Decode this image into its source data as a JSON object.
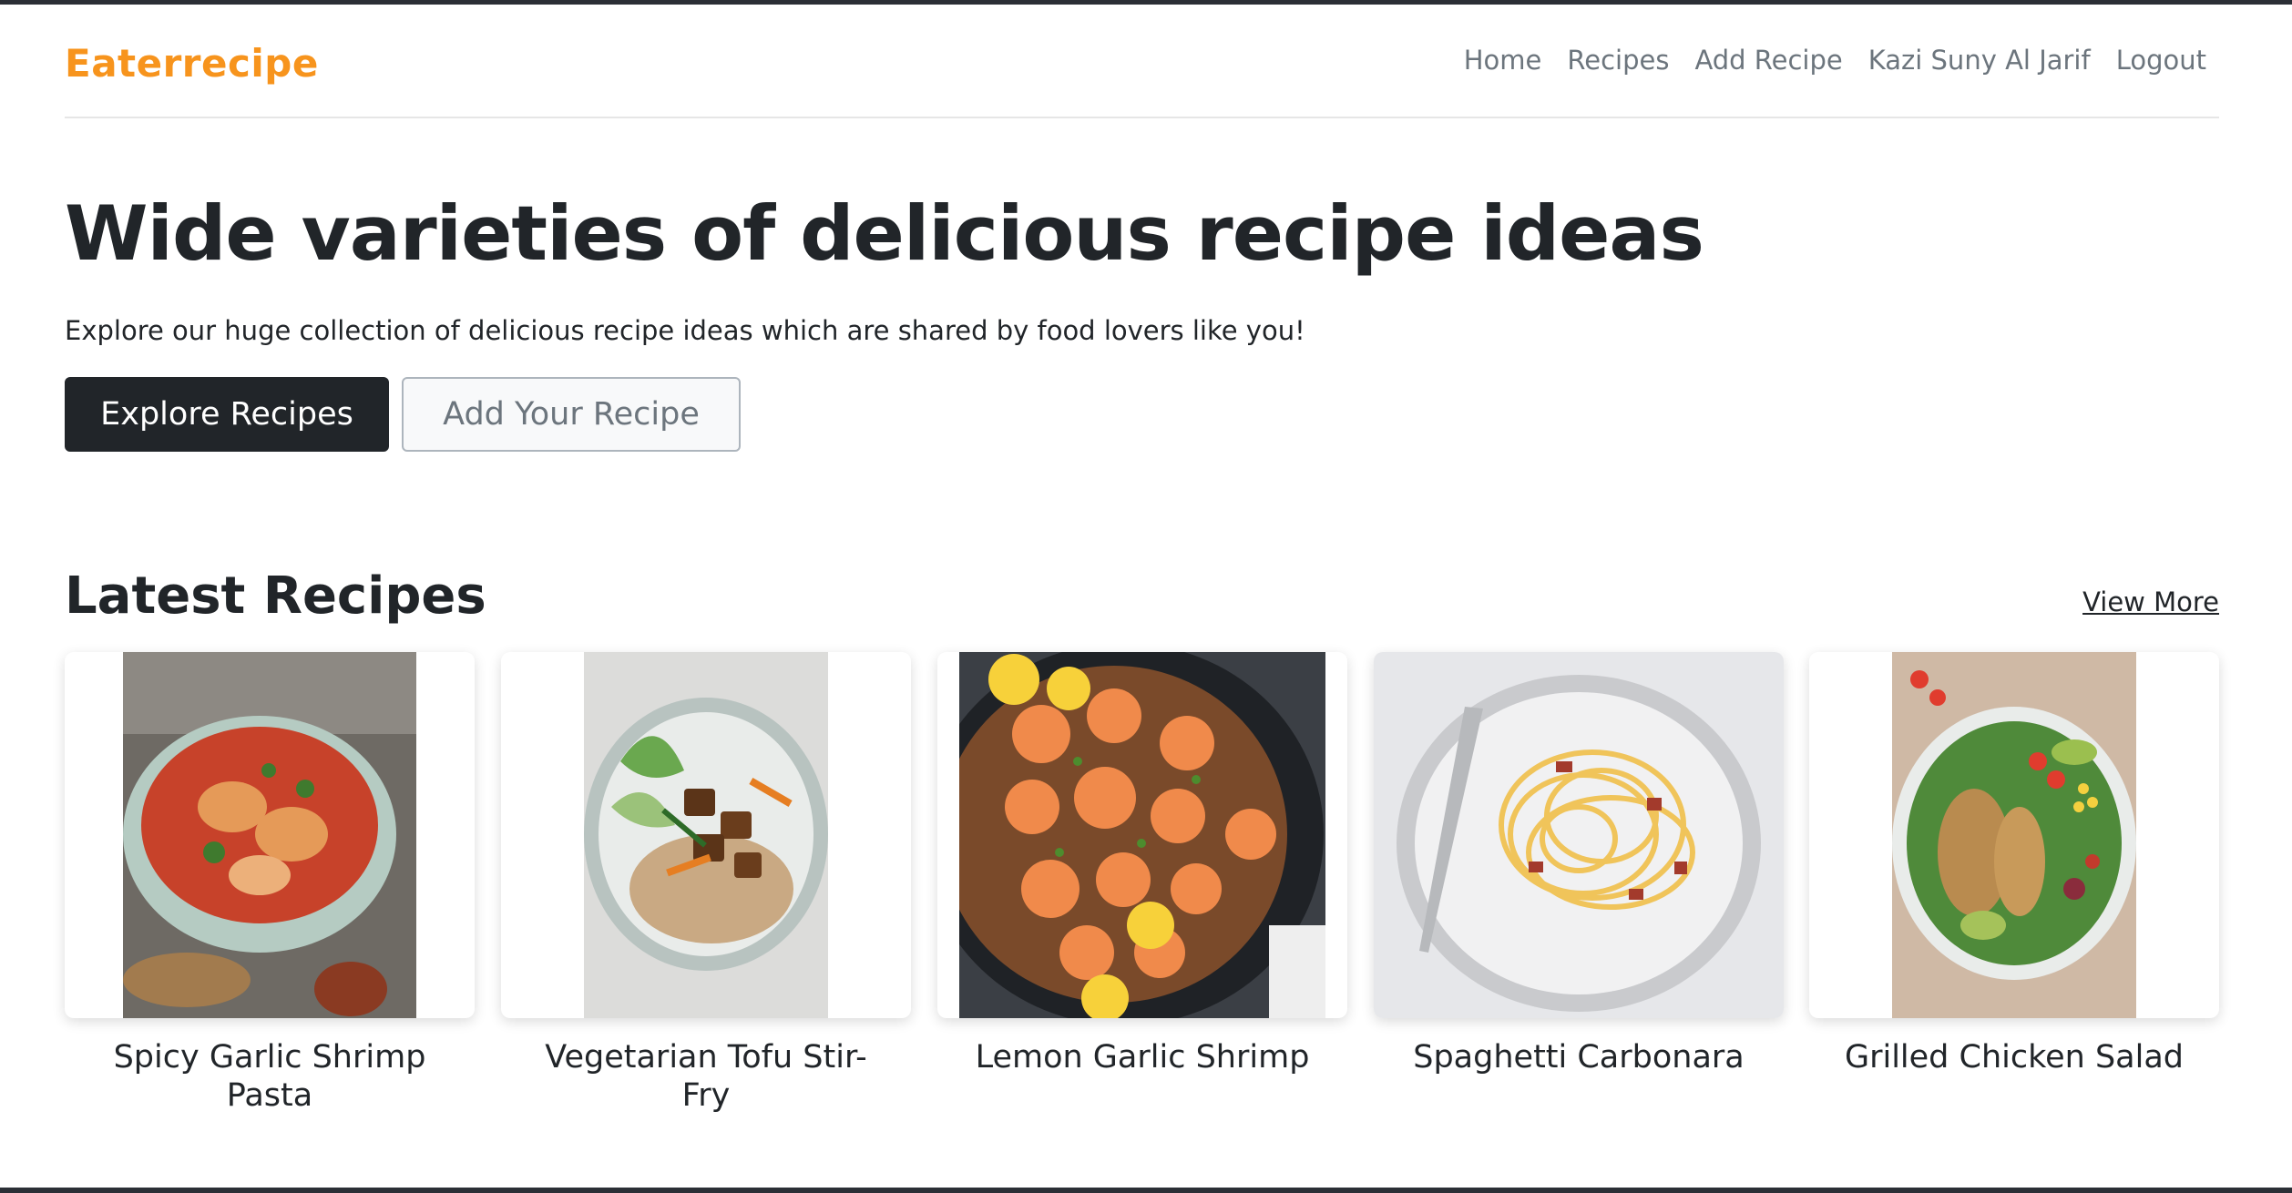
{
  "brand": "Eaterrecipe",
  "nav": {
    "links": [
      "Home",
      "Recipes",
      "Add Recipe",
      "Kazi Suny Al Jarif",
      "Logout"
    ]
  },
  "hero": {
    "title": "Wide varieties of delicious recipe ideas",
    "subtitle": "Explore our huge collection of delicious recipe ideas which are shared by food lovers like you!",
    "primary_button": "Explore Recipes",
    "secondary_button": "Add Your Recipe"
  },
  "latest": {
    "title": "Latest Recipes",
    "view_more": "View More",
    "recipes": [
      {
        "name": "Spicy Garlic Shrimp Pasta"
      },
      {
        "name": "Vegetarian Tofu Stir-Fry"
      },
      {
        "name": "Lemon Garlic Shrimp"
      },
      {
        "name": "Spaghetti Carbonara"
      },
      {
        "name": "Grilled Chicken Salad"
      }
    ]
  },
  "colors": {
    "brand": "#f7941d",
    "dark": "#212529",
    "muted": "#6c757d"
  }
}
